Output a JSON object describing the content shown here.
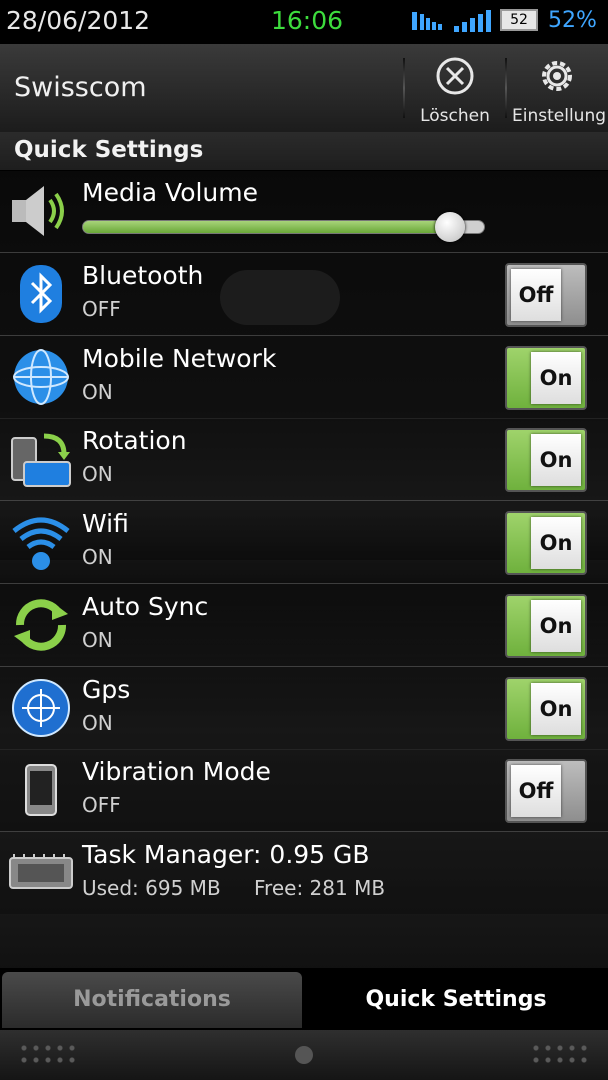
{
  "status_bar": {
    "date": "28/06/2012",
    "time": "16:06",
    "battery_level": "52",
    "battery_percent": "52%"
  },
  "header": {
    "carrier": "Swisscom",
    "clear_label": "Löschen",
    "settings_label": "Einstellung"
  },
  "section_title": "Quick Settings",
  "media_volume": {
    "label": "Media Volume",
    "level": 0.91
  },
  "settings": [
    {
      "label": "Bluetooth",
      "status": "OFF",
      "toggle": "Off"
    },
    {
      "label": "Mobile Network",
      "status": "ON",
      "toggle": "On"
    },
    {
      "label": "Rotation",
      "status": "ON",
      "toggle": "On"
    },
    {
      "label": "Wifi",
      "status": "ON",
      "toggle": "On"
    },
    {
      "label": "Auto Sync",
      "status": "ON",
      "toggle": "On"
    },
    {
      "label": "Gps",
      "status": "ON",
      "toggle": "On"
    },
    {
      "label": "Vibration Mode",
      "status": "OFF",
      "toggle": "Off"
    }
  ],
  "task_manager": {
    "label": "Task Manager: 0.95 GB",
    "used": "Used: 695 MB",
    "free": "Free: 281 MB"
  },
  "tabs": {
    "notifications": "Notifications",
    "quick_settings": "Quick Settings"
  },
  "colors": {
    "accent_green": "#6fb13d",
    "clock_green": "#3ddc3d",
    "battery_blue": "#3fa6ff"
  }
}
